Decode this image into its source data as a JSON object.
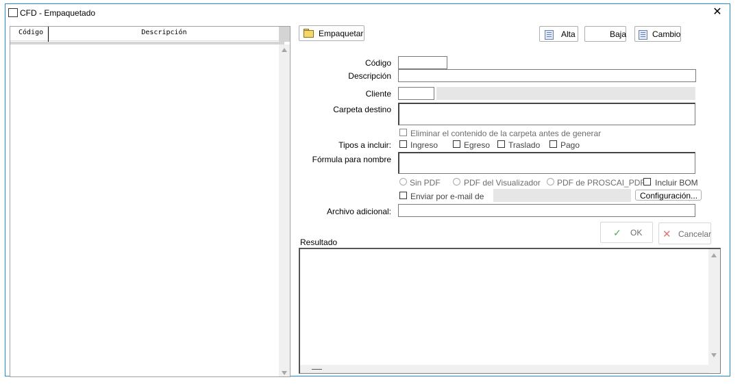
{
  "window": {
    "title": "CFD - Empaquetado",
    "close_glyph": "✕"
  },
  "grid": {
    "columns": [
      "Código",
      "Descripción"
    ],
    "rows": []
  },
  "toolbar": {
    "empaquetar_label": "Empaquetar",
    "alta_label": "Alta",
    "baja_label": "Baja",
    "cambio_label": "Cambio"
  },
  "form": {
    "codigo_label": "Código",
    "codigo_value": "",
    "descripcion_label": "Descripción",
    "descripcion_value": "",
    "cliente_label": "Cliente",
    "cliente_value": "",
    "cliente_name": "",
    "carpeta_label": "Carpeta destino",
    "carpeta_value": "",
    "eliminar_label": "Eliminar el contenido de la carpeta antes de generar",
    "tipos_label": "Tipos a incluir:",
    "tipos": [
      "Ingreso",
      "Egreso",
      "Traslado",
      "Pago"
    ],
    "formula_label": "Fórmula para nombre",
    "formula_value": "",
    "pdf_options": [
      "Sin PDF",
      "PDF del Visualizador",
      "PDF de PROSCAI_PDF"
    ],
    "incluir_bom_label": "Incluir BOM",
    "enviar_email_label": "Enviar por e-mail de",
    "email_value": "",
    "configuracion_label": "Configuración...",
    "archivo_label": "Archivo adicional:",
    "archivo_value": ""
  },
  "actions": {
    "ok_label": "OK",
    "cancel_label": "Cancelar"
  },
  "result": {
    "label": "Resultado",
    "text": ""
  },
  "icons": [
    "window-icon",
    "close-icon",
    "folder-icon",
    "alta-icon",
    "cambio-icon",
    "ok-check-icon",
    "cancel-x-icon",
    "scroll-up-icon",
    "scroll-down-icon"
  ],
  "colors": {
    "window_border": "#1e8ad6",
    "ok_check": "#4caf50",
    "cancel_x": "#e57373"
  }
}
